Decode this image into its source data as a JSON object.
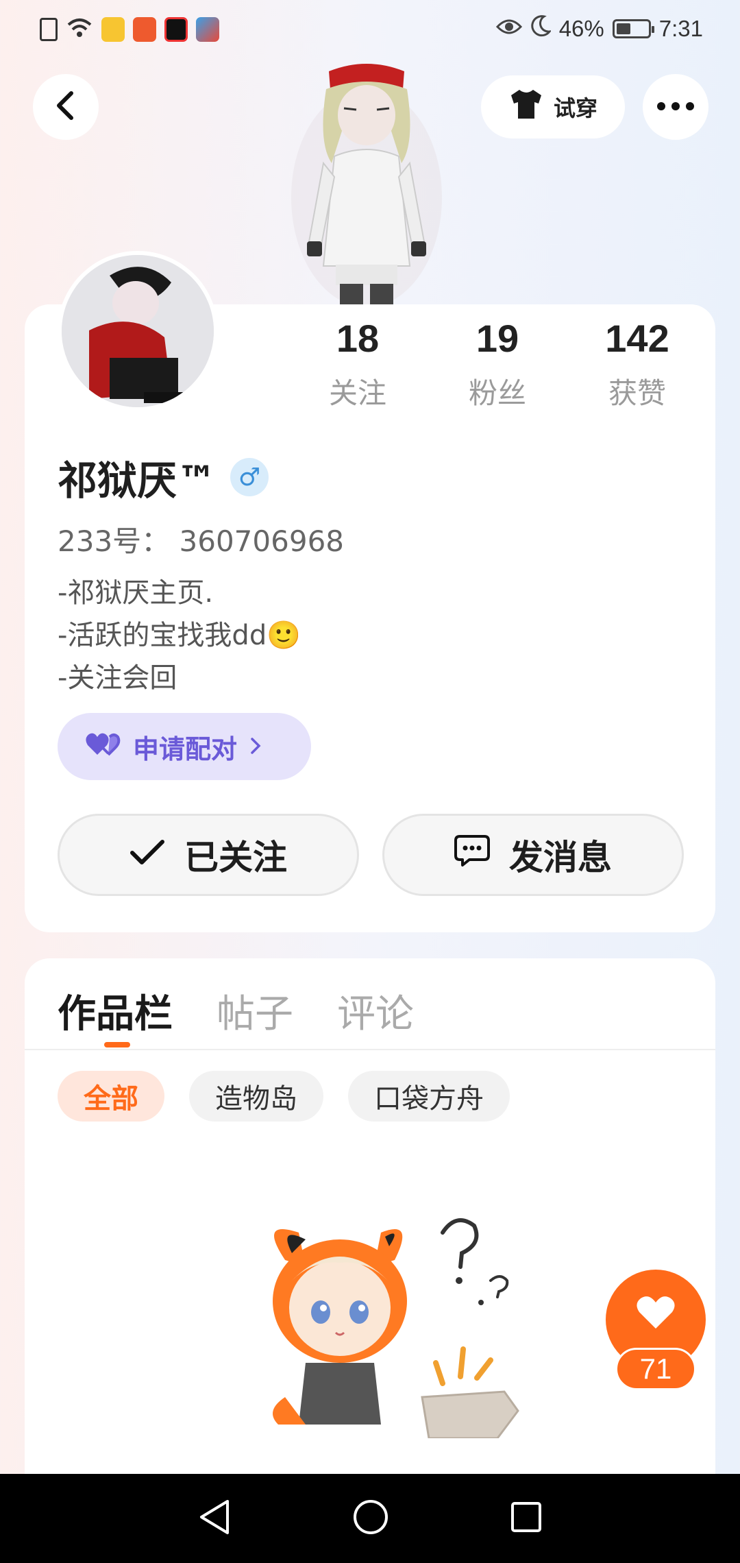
{
  "status_bar": {
    "battery_percent": "46%",
    "time": "7:31",
    "battery_level": 0.46
  },
  "nav": {
    "tryon_label": "试穿"
  },
  "stats": [
    {
      "value": "18",
      "label": "关注"
    },
    {
      "value": "19",
      "label": "粉丝"
    },
    {
      "value": "142",
      "label": "获赞"
    }
  ],
  "profile": {
    "name": "祁狱厌™",
    "gender_symbol": "♂",
    "uid_text": "233号： 360706968",
    "bio": [
      "-祁狱厌主页.",
      "-活跃的宝找我dd🙂",
      "-关注会回"
    ],
    "pair_label": "申请配对",
    "follow_label": "已关注",
    "message_label": "发消息"
  },
  "tabs": [
    "作品栏",
    "帖子",
    "评论"
  ],
  "chips": [
    "全部",
    "造物岛",
    "口袋方舟"
  ],
  "like_count": "71",
  "colors": {
    "accent_orange": "#ff6a1a",
    "pair_purple": "#6a5ad8",
    "gender_blue": "#3a8fd8"
  }
}
